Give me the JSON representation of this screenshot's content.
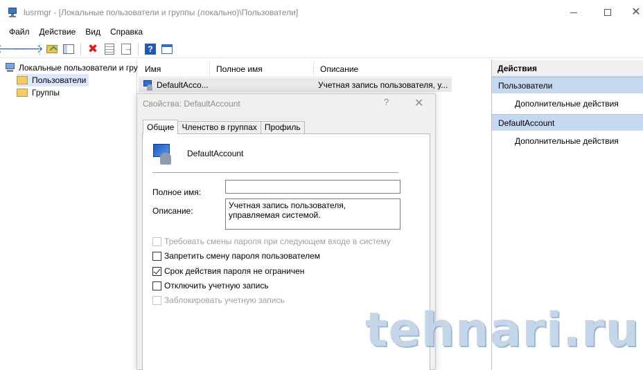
{
  "window": {
    "title": "lusrmgr - [Локальные пользователи и группы (локально)\\Пользователи]",
    "minimize": "—",
    "maximize": "☐",
    "close": "✕",
    "icon": "computer-management-icon"
  },
  "menu": {
    "items": [
      "Файл",
      "Действие",
      "Вид",
      "Справка"
    ]
  },
  "toolbar": {
    "icons": [
      "back-arrow-icon",
      "forward-arrow-icon",
      "up-folder-icon",
      "show-hide-tree-icon",
      "delete-icon",
      "properties-icon",
      "export-list-icon",
      "help-icon",
      "action-pane-icon"
    ],
    "help_glyph": "?",
    "colors": {
      "arrows": "#2b6fc0",
      "delete": "#d52020"
    }
  },
  "tree": {
    "root": "Локальные пользователи и гру",
    "users": "Пользователи",
    "groups": "Группы"
  },
  "list": {
    "columns": [
      "Имя",
      "Полное имя",
      "Описание"
    ],
    "rows": [
      {
        "name": "DefaultAcco...",
        "full_name": "",
        "description": "Учетная запись пользователя, у..."
      }
    ]
  },
  "actions": {
    "title": "Действия",
    "sections": [
      {
        "header": "Пользователи",
        "item": "Дополнительные действия"
      },
      {
        "header": "DefaultAccount",
        "item": "Дополнительные действия"
      }
    ],
    "header_color": "#c4d9ef"
  },
  "dialog": {
    "title": "Свойства: DefaultAccount",
    "help": "?",
    "close": "✕",
    "tabs": [
      "Общие",
      "Членство в группах",
      "Профиль"
    ],
    "active_tab": "Общие",
    "account_name": "DefaultAccount",
    "full_name_label": "Полное имя:",
    "full_name_value": "",
    "description_label": "Описание:",
    "description_value": "Учетная запись пользователя, управляемая системой.",
    "checkboxes": [
      {
        "label": "Требовать смены пароля при следующем входе в систему",
        "checked": false,
        "enabled": false
      },
      {
        "label": "Запретить смену пароля пользователем",
        "checked": false,
        "enabled": true
      },
      {
        "label": "Срок действия пароля не ограничен",
        "checked": true,
        "enabled": true
      },
      {
        "label": "Отключить учетную запись",
        "checked": false,
        "enabled": true
      },
      {
        "label": "Заблокировать учетную запись",
        "checked": false,
        "enabled": false
      }
    ]
  },
  "watermark": {
    "text": "tehnari.ru"
  }
}
